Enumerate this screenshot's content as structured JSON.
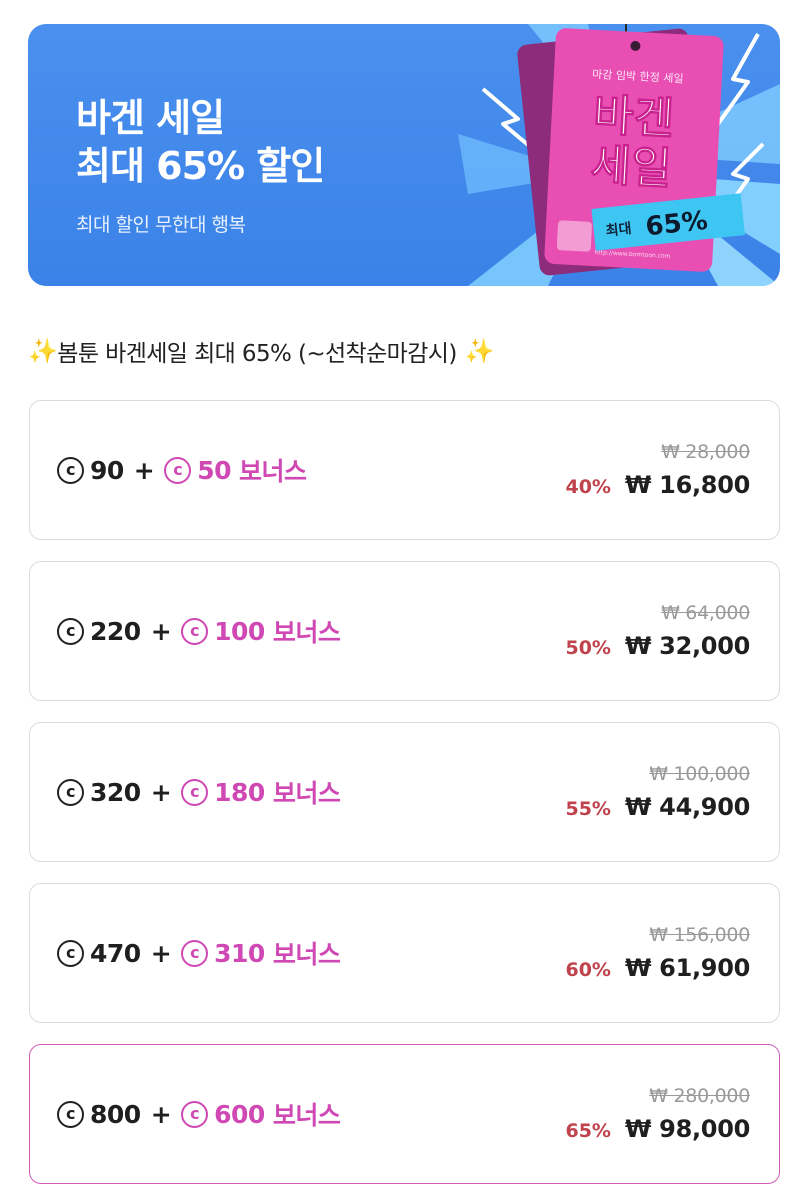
{
  "banner": {
    "title_line1": "바겐 세일",
    "title_line2": "최대 65% 할인",
    "subtitle": "최대 할인 무한대 행복",
    "tag": {
      "small_text": "마감 임박 한정 세일",
      "big_line1": "바겐",
      "big_line2": "세일",
      "badge_prefix": "최대",
      "badge_value": "65%"
    },
    "colors": {
      "background": "#3b82e8",
      "tag": "#e64bb0",
      "rays": "#8fd3ff"
    }
  },
  "headline": {
    "sparkle_left": "✨",
    "text": "봄툰 바겐세일 최대 65% (~선착순마감시)",
    "sparkle_right": "✨"
  },
  "coin_symbol": "c",
  "bonus_label": "보너스",
  "packages": [
    {
      "base": "90",
      "bonus": "50",
      "original": "₩ 28,000",
      "discount": "40%",
      "price": "₩ 16,800"
    },
    {
      "base": "220",
      "bonus": "100",
      "original": "₩ 64,000",
      "discount": "50%",
      "price": "₩ 32,000"
    },
    {
      "base": "320",
      "bonus": "180",
      "original": "₩ 100,000",
      "discount": "55%",
      "price": "₩ 44,900"
    },
    {
      "base": "470",
      "bonus": "310",
      "original": "₩ 156,000",
      "discount": "60%",
      "price": "₩ 61,900"
    },
    {
      "base": "800",
      "bonus": "600",
      "original": "₩ 280,000",
      "discount": "65%",
      "price": "₩ 98,000",
      "selected": true
    }
  ],
  "colors": {
    "accent_pink": "#cf48b3",
    "discount_red": "#c0424c",
    "selected_border": "#cf5bb8"
  }
}
